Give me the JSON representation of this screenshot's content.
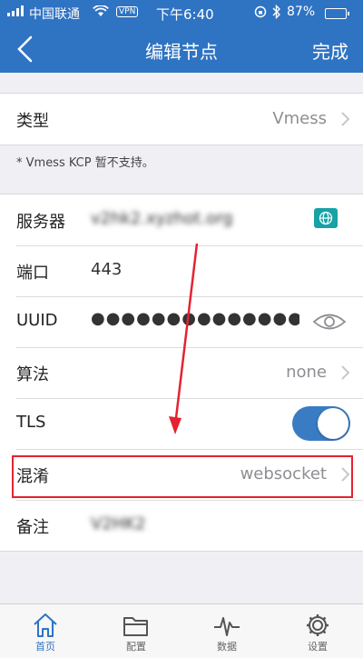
{
  "status_bar": {
    "carrier": "中国联通",
    "vpn": "VPN",
    "time": "下午6:40",
    "battery": "87%",
    "battery_level": 0.87
  },
  "nav": {
    "back_icon": "chevron-left-icon",
    "title": "编辑节点",
    "done": "完成"
  },
  "type_section": {
    "label": "类型",
    "value": "Vmess",
    "note": "* Vmess KCP 暂不支持。"
  },
  "server_section": {
    "server_label": "服务器",
    "server_value": "v2hk2.xyzhot.org",
    "port_label": "端口",
    "port_value": "443",
    "uuid_label": "UUID",
    "uuid_value": "●●●●●●●●●●●●●●●●●●●…",
    "algorithm_label": "算法",
    "algorithm_value": "none",
    "tls_label": "TLS",
    "tls_on": true,
    "obfs_label": "混淆",
    "obfs_value": "websocket",
    "remark_label": "备注",
    "remark_value": "V2HK2"
  },
  "tabbar": {
    "items": [
      {
        "label": "首页",
        "icon": "home-icon",
        "active": true
      },
      {
        "label": "配置",
        "icon": "folder-icon",
        "active": false
      },
      {
        "label": "数据",
        "icon": "pulse-icon",
        "active": false
      },
      {
        "label": "设置",
        "icon": "gear-icon",
        "active": false
      }
    ]
  },
  "colors": {
    "brand": "#2f73c3",
    "toggle_on": "#3a7cc4",
    "annotation_red": "#e52230"
  }
}
